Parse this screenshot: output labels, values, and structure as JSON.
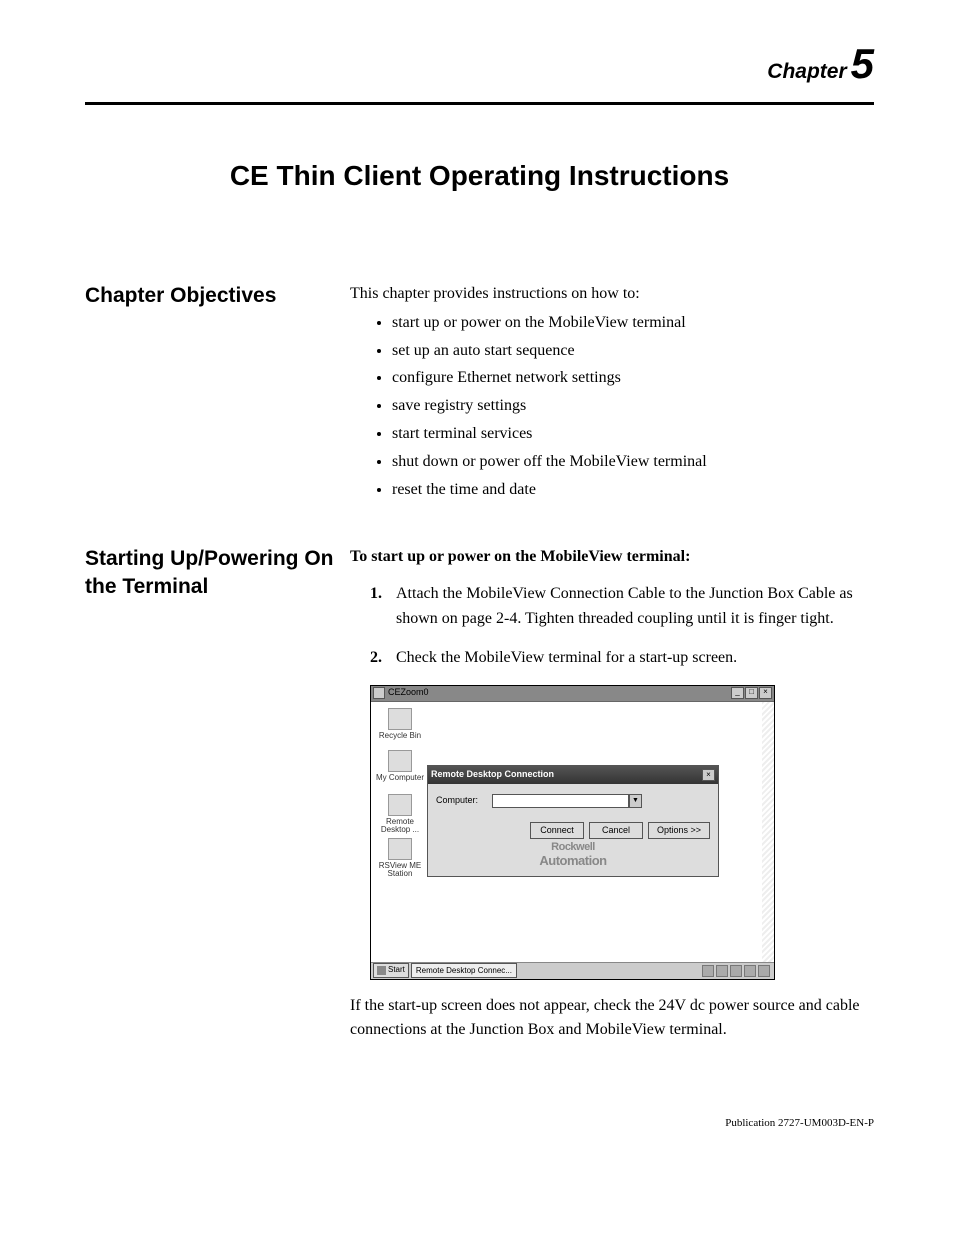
{
  "header": {
    "chapter_word": "Chapter",
    "chapter_num": "5"
  },
  "title": "CE Thin Client Operating Instructions",
  "objectives": {
    "heading": "Chapter Objectives",
    "intro": "This chapter provides instructions on how to:",
    "bullets": [
      "start up or power on the MobileView terminal",
      "set up an auto start sequence",
      "configure Ethernet network settings",
      "save registry settings",
      "start terminal services",
      "shut down or power off the MobileView terminal",
      "reset the time and date"
    ]
  },
  "starting": {
    "heading": "Starting Up/Powering On the Terminal",
    "lead": "To start up or power on the MobileView terminal:",
    "steps": [
      "Attach the MobileView Connection Cable to the Junction Box Cable as shown on page 2-4. Tighten threaded coupling until it is finger tight.",
      "Check the MobileView terminal for a start-up screen."
    ],
    "followup": "If the start-up screen does not appear, check the 24V dc power source and cable connections at the Junction Box and MobileView terminal."
  },
  "screenshot": {
    "window_title": "CEZoom0",
    "desktop_icons": [
      {
        "label": "Recycle Bin"
      },
      {
        "label": "My Computer"
      },
      {
        "label": "Remote Desktop ..."
      },
      {
        "label": "RSView ME Station"
      }
    ],
    "rdc": {
      "title": "Remote Desktop Connection",
      "computer_label": "Computer:",
      "computer_value": "",
      "buttons": {
        "connect": "Connect",
        "cancel": "Cancel",
        "options": "Options >>"
      },
      "brand_line1": "Rockwell",
      "brand_line2": "Automation"
    },
    "taskbar": {
      "start": "Start",
      "task": "Remote Desktop Connec..."
    }
  },
  "footer": "Publication 2727-UM003D-EN-P"
}
